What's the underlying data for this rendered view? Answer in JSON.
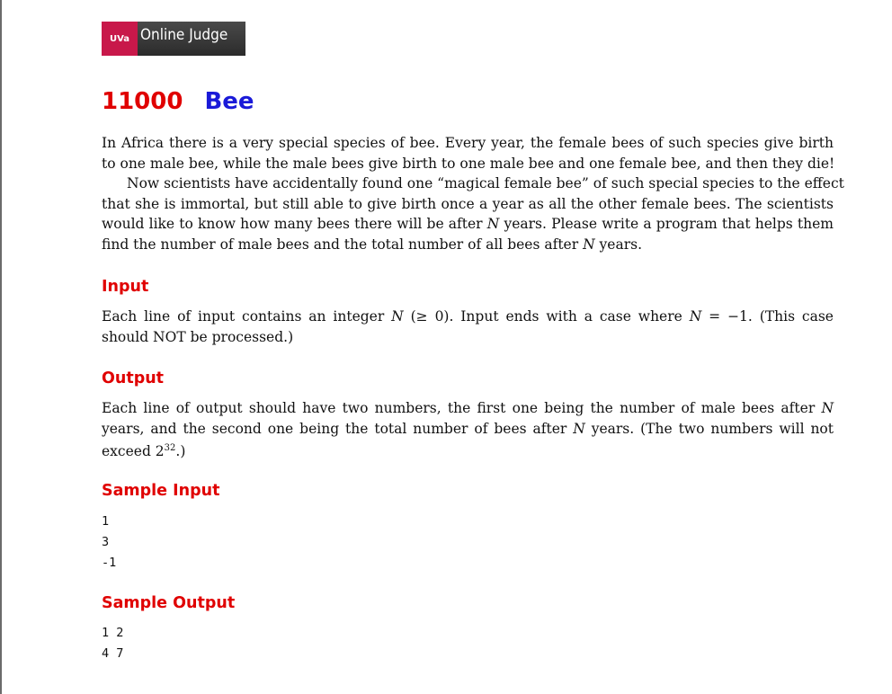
{
  "logo": {
    "mark": "UVa",
    "text": "Online Judge"
  },
  "problem": {
    "number": "11000",
    "name": "Bee"
  },
  "statement": {
    "p1_l1": "In Africa there is a very special species of bee. Every year, the female bees of such species give birth",
    "p1_l2": "to one male bee, while the male bees give birth to one male bee and one female bee, and then they die!",
    "p2_l1": "Now scientists have accidentally found one “magical female bee” of such special species to the effect",
    "p2_l2": "that she is immortal, but still able to give birth once a year as all the other female bees. The scientists",
    "p2_l3a": "would like to know how many bees there will be after ",
    "p2_l3b": "N",
    "p2_l3c": " years. Please write a program that helps them",
    "p2_l4a": "find the number of male bees and the total number of all bees after ",
    "p2_l4b": "N",
    "p2_l4c": " years."
  },
  "input": {
    "heading": "Input",
    "l1a": "Each line of input contains an integer ",
    "l1b": "N",
    "l1c": " (≥ 0). Input ends with a case where ",
    "l1d": "N",
    "l1e": " = −1. (This case",
    "l2": "should NOT be processed.)"
  },
  "output": {
    "heading": "Output",
    "l1a": "Each line of output should have two numbers, the first one being the number of male bees after ",
    "l1b": "N",
    "l2a": "years, and the second one being the total number of bees after ",
    "l2b": "N",
    "l2c": " years. (The two numbers will not",
    "l3a": "exceed 2",
    "l3sup": "32",
    "l3b": ".)"
  },
  "sample_input": {
    "heading": "Sample Input",
    "lines": "1\n3\n-1"
  },
  "sample_output": {
    "heading": "Sample Output",
    "lines": "1 2\n4 7"
  }
}
